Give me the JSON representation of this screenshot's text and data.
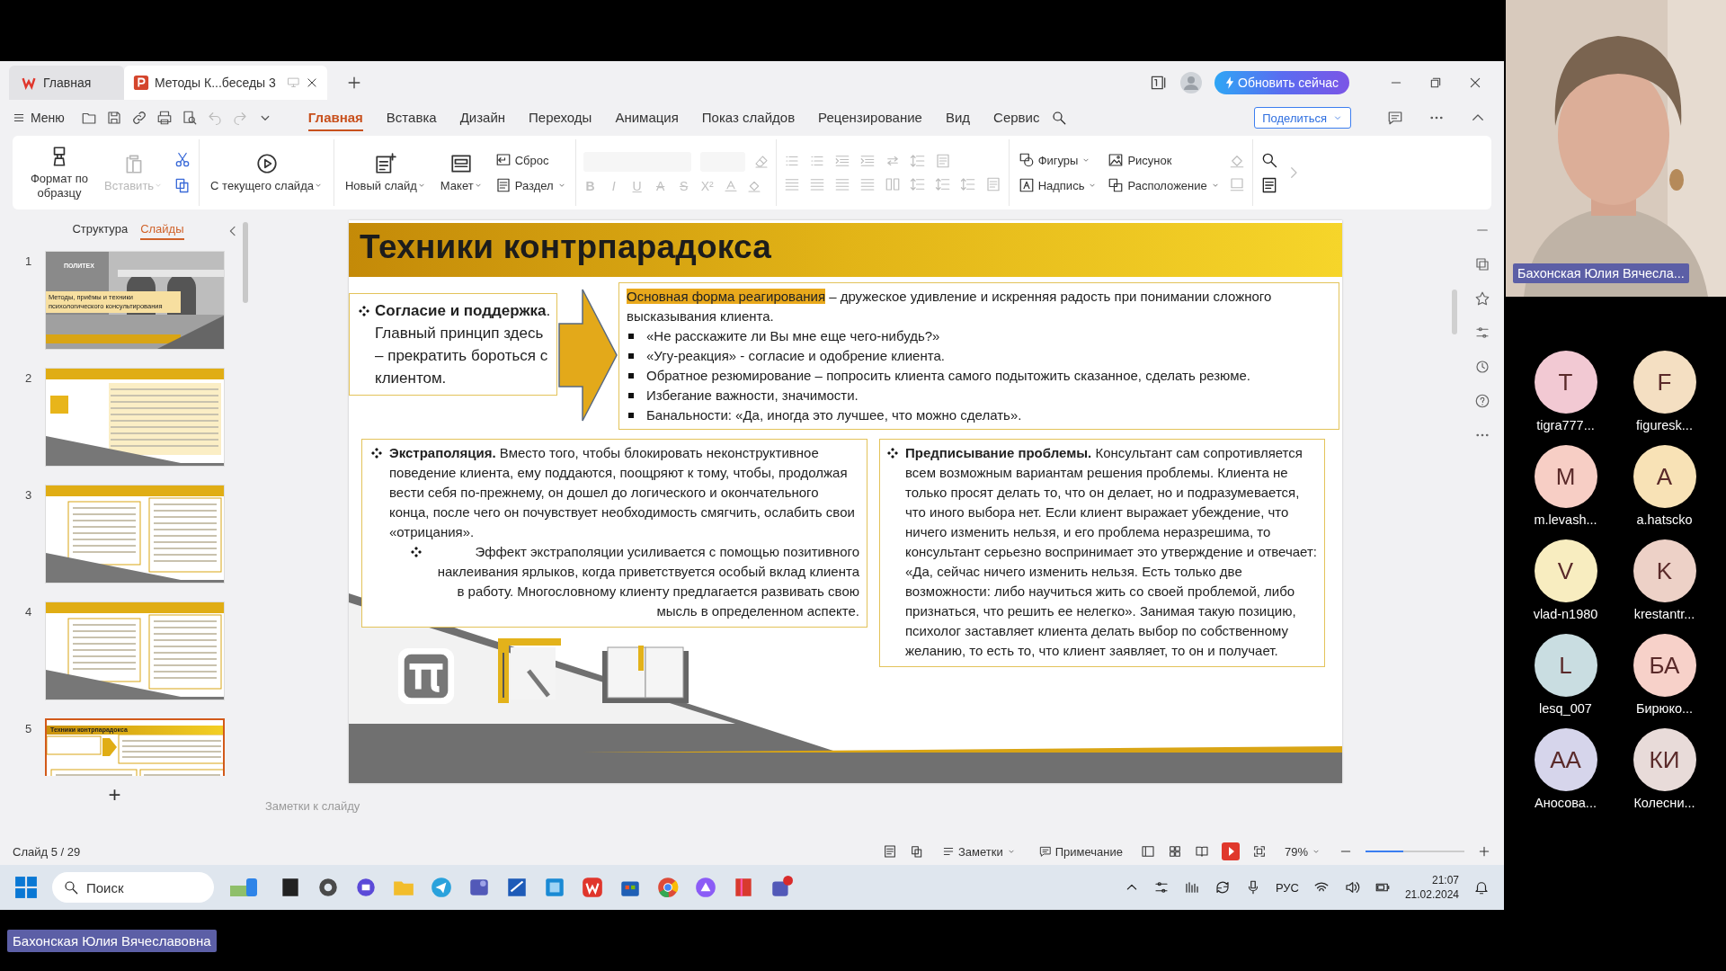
{
  "window": {
    "tabs": [
      {
        "label": "Главная",
        "kind": "home",
        "selected": false
      },
      {
        "label": "Методы К...беседы 3",
        "kind": "document",
        "selected": true
      }
    ],
    "update_button": "Обновить сейчас"
  },
  "menu_bar": {
    "menu": "Меню",
    "tabs": [
      {
        "label": "Главная",
        "selected": true
      },
      {
        "label": "Вставка",
        "selected": false
      },
      {
        "label": "Дизайн",
        "selected": false
      },
      {
        "label": "Переходы",
        "selected": false
      },
      {
        "label": "Анимация",
        "selected": false
      },
      {
        "label": "Показ слайдов",
        "selected": false
      },
      {
        "label": "Рецензирование",
        "selected": false
      },
      {
        "label": "Вид",
        "selected": false
      },
      {
        "label": "Сервис",
        "selected": false
      }
    ],
    "share_button": "Поделиться"
  },
  "ribbon": {
    "groups": [
      {
        "large": [
          {
            "label": "Формат по образцу",
            "disabled": false,
            "dropdown": false
          },
          {
            "label": "Вставить",
            "disabled": true,
            "dropdown": true
          }
        ]
      },
      {
        "large": [
          {
            "label": "С текущего слайда",
            "disabled": false,
            "dropdown": true
          }
        ]
      },
      {
        "large": [
          {
            "label": "Новый слайд",
            "disabled": false,
            "dropdown": true
          },
          {
            "label": "Макет",
            "disabled": false,
            "dropdown": true
          }
        ],
        "small": [
          {
            "label": "Сброс",
            "disabled": false,
            "dropdown": false
          },
          {
            "label": "Раздел",
            "disabled": false,
            "dropdown": true
          }
        ]
      },
      {
        "small": [
          {
            "label": "Фигуры",
            "disabled": false,
            "dropdown": true
          },
          {
            "label": "Рисунок",
            "disabled": false,
            "dropdown": false
          },
          {
            "label": "Надпись",
            "disabled": false,
            "dropdown": true
          },
          {
            "label": "Расположение",
            "disabled": false,
            "dropdown": true
          }
        ]
      }
    ],
    "format_glyphs": [
      {
        "text": "B",
        "disabled": true
      },
      {
        "text": "I",
        "disabled": true
      },
      {
        "text": "U",
        "disabled": true
      },
      {
        "text": "A",
        "disabled": true
      },
      {
        "text": "S",
        "disabled": true
      },
      {
        "text": "X²",
        "disabled": true
      }
    ]
  },
  "slide_panel": {
    "tabs": [
      {
        "label": "Структура",
        "selected": false
      },
      {
        "label": "Слайды",
        "selected": true
      }
    ],
    "slides": [
      {
        "number": "1",
        "kind": "cover",
        "selected": false,
        "brand": "ПОЛИТЕХ",
        "title": "Методы, приёмы и техники психологического консультирования"
      },
      {
        "number": "2",
        "kind": "table",
        "selected": false
      },
      {
        "number": "3",
        "kind": "columns",
        "selected": false
      },
      {
        "number": "4",
        "kind": "columns",
        "selected": false
      },
      {
        "number": "5",
        "kind": "current",
        "selected": true,
        "title": "Техники контрпарадокса"
      }
    ],
    "add_button": "+"
  },
  "slide": {
    "title": "Техники контрпарадокса",
    "agreement": "**Согласие и поддержка**. Главный принцип здесь – прекратить бороться с клиентом.",
    "main_form": {
      "highlight": "Основная форма реагирования",
      "text": " – дружеское удивление и искренняя радость при понимании сложного высказывания клиента."
    },
    "bullets": [
      "«Не расскажите ли Вы мне еще чего-нибудь?»",
      "«Угу-реакция» - согласие и одобрение клиента.",
      "Обратное резюмирование – попросить клиента самого подытожить сказанное, сделать резюме.",
      "Избегание важности, значимости.",
      "Банальности: «Да, иногда это лучшее, что можно сделать»."
    ],
    "extrapolation": "**Экстраполяция.** Вместо того, чтобы блокировать неконструктивное поведение клиента, ему поддаются, поощряют к тому, чтобы, продолжая вести себя по-прежнему, он дошел до логического и окончательного конца, после чего он почувствует необходимость смягчить, ослабить свои «отрицания».",
    "extrapolation_effect": "Эффект экстраполяции усиливается с помощью позитивного наклеивания ярлыков, когда приветствуется особый вклад клиента в работу. Многословному клиенту предлагается развивать свою мысль в определенном аспекте.",
    "prescription": "**Предписывание проблемы.** Консультант сам сопротивляется всем возможным вариантам решения проблемы. Клиента не только просят делать то, что он делает, но и подразумевается, что иного выбора нет. Если клиент выражает убеждение, что ничего изменить нельзя, и его проблема неразрешима, то консультант серьезно воспринимает это утверждение и отвечает: «Да, сейчас ничего изменить нельзя. Есть только две возможности: либо научиться жить со своей проблемой, либо признаться, что решить ее нелегко». Занимая такую позицию, психолог заставляет клиента делать выбор по собственному желанию, то есть то, что клиент заявляет, то он и получает."
  },
  "notes": {
    "placeholder": "Заметки к слайду"
  },
  "status_bar": {
    "slide_counter": "Слайд 5 / 29",
    "notes_button": "Заметки",
    "comment_button": "Примечание",
    "zoom": "79%",
    "zoom_level": {
      "level": 0.38
    }
  },
  "taskbar": {
    "search": {
      "placeholder": "Поиск"
    },
    "language": "РУС",
    "time": "21:07",
    "date": "21.02.2024"
  },
  "meeting": {
    "speaker": "Бахонская Юлия Вячесла...",
    "participants": [
      {
        "initials": "T",
        "name": "tigra777...",
        "color": "#f2c9d3"
      },
      {
        "initials": "F",
        "name": "figuresk...",
        "color": "#f4dfc2"
      },
      {
        "initials": "M",
        "name": "m.levash...",
        "color": "#f7cec5"
      },
      {
        "initials": "A",
        "name": "a.hatscko",
        "color": "#f8e2b6"
      },
      {
        "initials": "V",
        "name": "vlad-n1980",
        "color": "#f8edc0"
      },
      {
        "initials": "K",
        "name": "krestantr...",
        "color": "#edd1c7"
      },
      {
        "initials": "L",
        "name": "lesq_007",
        "color": "#c9dde1"
      },
      {
        "initials": "БА",
        "name": "Бирюко...",
        "color": "#f7d1c9"
      },
      {
        "initials": "АА",
        "name": "Аносова...",
        "color": "#d6d5eb"
      },
      {
        "initials": "КИ",
        "name": "Колесни...",
        "color": "#e8dbd9"
      }
    ],
    "presenter_label": "Бахонская Юлия Вячеславовна"
  }
}
